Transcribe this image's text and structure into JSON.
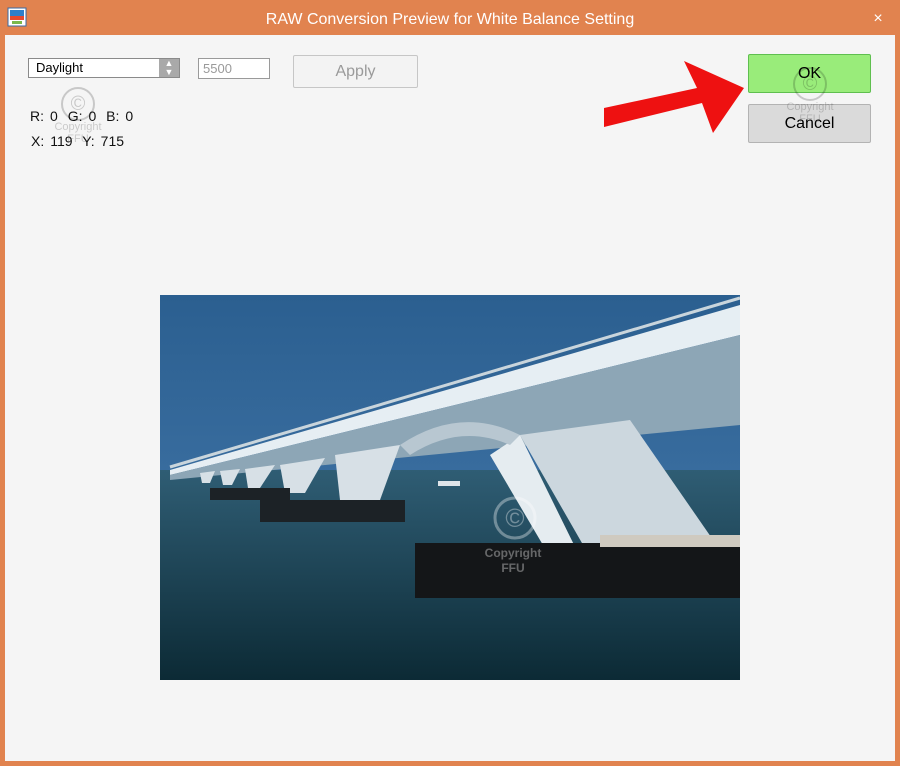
{
  "window": {
    "title": "RAW Conversion Preview for White Balance Setting",
    "close_glyph": "×"
  },
  "controls": {
    "white_balance_selected": "Daylight",
    "temperature_value": "5500",
    "apply_label": "Apply",
    "ok_label": "OK",
    "cancel_label": "Cancel"
  },
  "readout": {
    "r_label": "R:",
    "r_value": "0",
    "g_label": "G:",
    "g_value": "0",
    "b_label": "B:",
    "b_value": "0",
    "x_label": "X:",
    "x_value": "119",
    "y_label": "Y:",
    "y_value": "715"
  },
  "watermark": {
    "symbol": "©",
    "line1": "Copyright",
    "line2": "FFU"
  },
  "icons": {
    "app": "app-icon",
    "close": "close-icon",
    "dropdown": "chevron-updown-icon",
    "pointer": "red-arrow-icon"
  },
  "colors": {
    "frame": "#e1834f",
    "ok_green": "#99ec7a",
    "arrow_red": "#ee1111"
  }
}
